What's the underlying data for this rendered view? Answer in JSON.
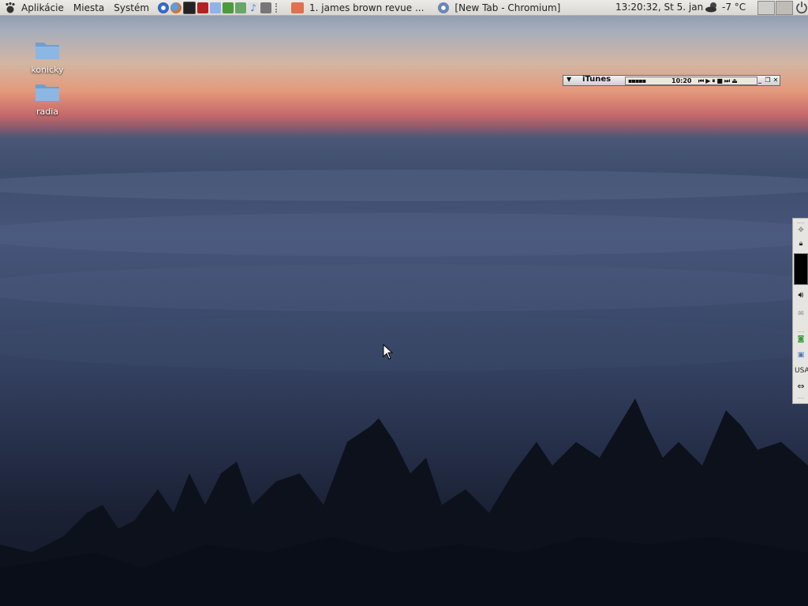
{
  "panel": {
    "menus": [
      "Aplikácie",
      "Miesta",
      "Systém"
    ],
    "launchers": [
      "chromium-icon",
      "firefox-icon",
      "terminal-icon",
      "pdf-icon",
      "files-icon",
      "tools-icon",
      "download-icon",
      "music-icon",
      "archive-icon"
    ],
    "tasks": [
      {
        "label": "1. james brown revue ...",
        "icon": "radio-app-icon"
      },
      {
        "label": "[New Tab - Chromium]",
        "icon": "chromium-icon"
      }
    ],
    "clock": "13:20:32, St  5. jan",
    "temperature": "-7 °C",
    "workspaces": 2
  },
  "desktop": {
    "icons": [
      {
        "label": "konicky"
      },
      {
        "label": "radia"
      }
    ]
  },
  "itunes": {
    "title": "iTunes",
    "time": "10:20"
  },
  "dock": {
    "keyboard_layout": "USA"
  }
}
